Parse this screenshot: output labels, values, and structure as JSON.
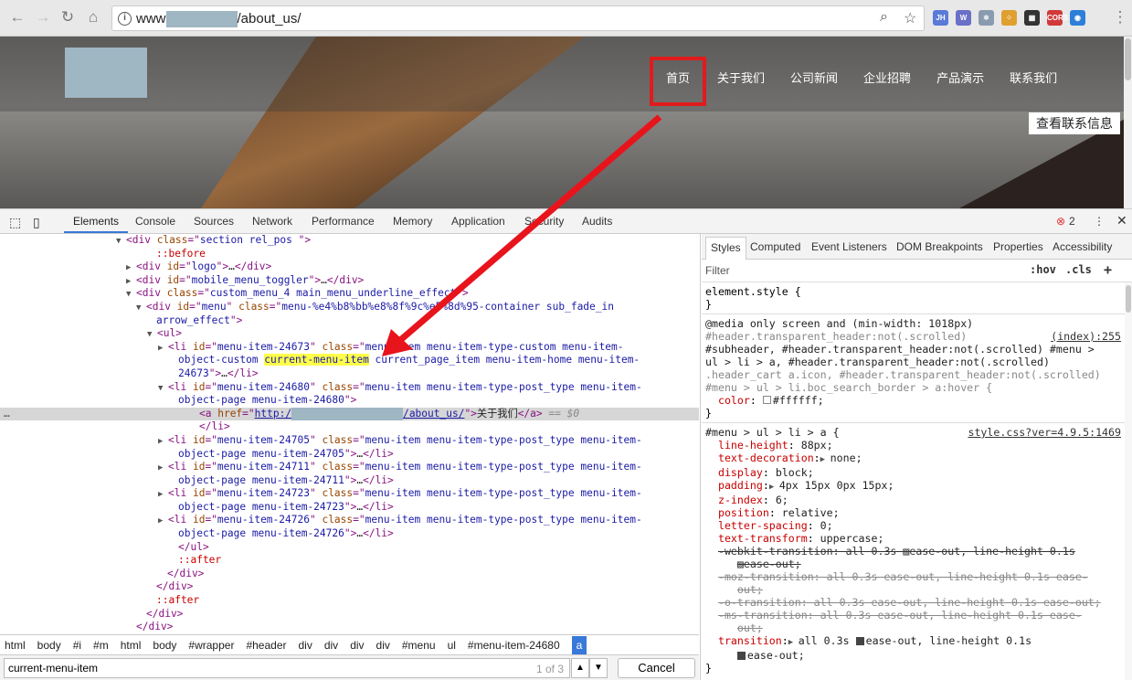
{
  "browser": {
    "url_prefix": "www",
    "url_suffix": "/about_us/",
    "extensions": [
      {
        "label": "JH",
        "color": "#5a7ad8"
      },
      {
        "label": "W",
        "color": "#6a6fc8"
      },
      {
        "label": "⚛",
        "color": "#8a9bb0"
      },
      {
        "label": "⁘",
        "color": "#e0a030"
      },
      {
        "label": "▦",
        "color": "#333333"
      },
      {
        "label": "CORS",
        "color": "#d03a3a"
      },
      {
        "label": "◉",
        "color": "#2d7fd8"
      }
    ]
  },
  "page": {
    "menu": [
      "首页",
      "关于我们",
      "公司新闻",
      "企业招聘",
      "产品演示",
      "联系我们"
    ],
    "contact_button": "查看联系信息"
  },
  "devtools": {
    "tabs": [
      "Elements",
      "Console",
      "Sources",
      "Network",
      "Performance",
      "Memory",
      "Application",
      "Security",
      "Audits"
    ],
    "error_count": "2",
    "elements": [
      {
        "d": 0,
        "a": "▼",
        "p": [
          [
            "tg",
            "<div "
          ],
          [
            "at",
            "class"
          ],
          [
            "tg",
            "=\""
          ],
          [
            "av",
            "section rel_pos "
          ],
          [
            "tg",
            "\">"
          ]
        ]
      },
      {
        "d": 1,
        "a": "",
        "p": [
          [
            "pe",
            "::before"
          ]
        ]
      },
      {
        "d": 1,
        "a": "▶",
        "p": [
          [
            "tg",
            "<div "
          ],
          [
            "at",
            "id"
          ],
          [
            "tg",
            "=\""
          ],
          [
            "av",
            "logo"
          ],
          [
            "tg",
            "\">"
          ],
          [
            "tx",
            "…"
          ],
          [
            "tg",
            "</div>"
          ]
        ]
      },
      {
        "d": 1,
        "a": "▶",
        "p": [
          [
            "tg",
            "<div "
          ],
          [
            "at",
            "id"
          ],
          [
            "tg",
            "=\""
          ],
          [
            "av",
            "mobile_menu_toggler"
          ],
          [
            "tg",
            "\">"
          ],
          [
            "tx",
            "…"
          ],
          [
            "tg",
            "</div>"
          ]
        ]
      },
      {
        "d": 1,
        "a": "▼",
        "p": [
          [
            "tg",
            "<div "
          ],
          [
            "at",
            "class"
          ],
          [
            "tg",
            "=\""
          ],
          [
            "av",
            "custom_menu_4 main_menu_underline_effect"
          ],
          [
            "tg",
            "\">"
          ]
        ]
      },
      {
        "d": 2,
        "a": "▼",
        "p": [
          [
            "tg",
            "<div "
          ],
          [
            "at",
            "id"
          ],
          [
            "tg",
            "=\""
          ],
          [
            "av",
            "menu"
          ],
          [
            "tg",
            "\" "
          ],
          [
            "at",
            "class"
          ],
          [
            "tg",
            "=\""
          ],
          [
            "av",
            "menu-%e4%b8%bb%e8%8f%9c%e5%8d%95-container sub_fade_in"
          ]
        ]
      },
      {
        "d": 2,
        "a": "",
        "p": [
          [
            "av",
            "arrow_effect"
          ],
          [
            "tg",
            "\">"
          ]
        ]
      },
      {
        "d": 3,
        "a": "▼",
        "p": [
          [
            "tg",
            "<ul>"
          ]
        ]
      },
      {
        "d": 4,
        "a": "▶",
        "p": [
          [
            "tg",
            "<li "
          ],
          [
            "at",
            "id"
          ],
          [
            "tg",
            "=\""
          ],
          [
            "av",
            "menu-item-24673"
          ],
          [
            "tg",
            "\" "
          ],
          [
            "at",
            "class"
          ],
          [
            "tg",
            "=\""
          ],
          [
            "av",
            "menu-item menu-item-type-custom menu-item-"
          ]
        ]
      },
      {
        "d": 4,
        "a": "",
        "p": [
          [
            "av",
            "object-custom "
          ],
          [
            "hl",
            "current-menu-item"
          ],
          [
            "av",
            " current_page_item menu-item-home menu-item-"
          ]
        ]
      },
      {
        "d": 4,
        "a": "",
        "p": [
          [
            "av",
            "24673"
          ],
          [
            "tg",
            "\">"
          ],
          [
            "tx",
            "…"
          ],
          [
            "tg",
            "</li>"
          ]
        ]
      },
      {
        "d": 4,
        "a": "▼",
        "p": [
          [
            "tg",
            "<li "
          ],
          [
            "at",
            "id"
          ],
          [
            "tg",
            "=\""
          ],
          [
            "av",
            "menu-item-24680"
          ],
          [
            "tg",
            "\" "
          ],
          [
            "at",
            "class"
          ],
          [
            "tg",
            "=\""
          ],
          [
            "av",
            "menu-item menu-item-type-post_type menu-item-"
          ]
        ]
      },
      {
        "d": 4,
        "a": "",
        "p": [
          [
            "av",
            "object-page menu-item-24680"
          ],
          [
            "tg",
            "\">"
          ]
        ]
      },
      {
        "d": 5,
        "a": "",
        "sel": true,
        "p": [
          [
            "tg",
            "<a "
          ],
          [
            "at",
            "href"
          ],
          [
            "tg",
            "=\""
          ],
          [
            "lk",
            "http:/"
          ],
          [
            "blur",
            ""
          ],
          [
            "lk",
            "/about_us/"
          ],
          [
            "tg",
            "\">"
          ],
          [
            "tx",
            "关于我们"
          ],
          [
            "tg",
            "</a>"
          ],
          [
            "dl",
            " == $0"
          ]
        ]
      },
      {
        "d": 5,
        "a": "",
        "p": [
          [
            "tg",
            "</li>"
          ]
        ]
      },
      {
        "d": 4,
        "a": "▶",
        "p": [
          [
            "tg",
            "<li "
          ],
          [
            "at",
            "id"
          ],
          [
            "tg",
            "=\""
          ],
          [
            "av",
            "menu-item-24705"
          ],
          [
            "tg",
            "\" "
          ],
          [
            "at",
            "class"
          ],
          [
            "tg",
            "=\""
          ],
          [
            "av",
            "menu-item menu-item-type-post_type menu-item-"
          ]
        ]
      },
      {
        "d": 4,
        "a": "",
        "p": [
          [
            "av",
            "object-page menu-item-24705"
          ],
          [
            "tg",
            "\">"
          ],
          [
            "tx",
            "…"
          ],
          [
            "tg",
            "</li>"
          ]
        ]
      },
      {
        "d": 4,
        "a": "▶",
        "p": [
          [
            "tg",
            "<li "
          ],
          [
            "at",
            "id"
          ],
          [
            "tg",
            "=\""
          ],
          [
            "av",
            "menu-item-24711"
          ],
          [
            "tg",
            "\" "
          ],
          [
            "at",
            "class"
          ],
          [
            "tg",
            "=\""
          ],
          [
            "av",
            "menu-item menu-item-type-post_type menu-item-"
          ]
        ]
      },
      {
        "d": 4,
        "a": "",
        "p": [
          [
            "av",
            "object-page menu-item-24711"
          ],
          [
            "tg",
            "\">"
          ],
          [
            "tx",
            "…"
          ],
          [
            "tg",
            "</li>"
          ]
        ]
      },
      {
        "d": 4,
        "a": "▶",
        "p": [
          [
            "tg",
            "<li "
          ],
          [
            "at",
            "id"
          ],
          [
            "tg",
            "=\""
          ],
          [
            "av",
            "menu-item-24723"
          ],
          [
            "tg",
            "\" "
          ],
          [
            "at",
            "class"
          ],
          [
            "tg",
            "=\""
          ],
          [
            "av",
            "menu-item menu-item-type-post_type menu-item-"
          ]
        ]
      },
      {
        "d": 4,
        "a": "",
        "p": [
          [
            "av",
            "object-page menu-item-24723"
          ],
          [
            "tg",
            "\">"
          ],
          [
            "tx",
            "…"
          ],
          [
            "tg",
            "</li>"
          ]
        ]
      },
      {
        "d": 4,
        "a": "▶",
        "p": [
          [
            "tg",
            "<li "
          ],
          [
            "at",
            "id"
          ],
          [
            "tg",
            "=\""
          ],
          [
            "av",
            "menu-item-24726"
          ],
          [
            "tg",
            "\" "
          ],
          [
            "at",
            "class"
          ],
          [
            "tg",
            "=\""
          ],
          [
            "av",
            "menu-item menu-item-type-post_type menu-item-"
          ]
        ]
      },
      {
        "d": 4,
        "a": "",
        "p": [
          [
            "av",
            "object-page menu-item-24726"
          ],
          [
            "tg",
            "\">"
          ],
          [
            "tx",
            "…"
          ],
          [
            "tg",
            "</li>"
          ]
        ]
      },
      {
        "d": 4,
        "a": "",
        "p": [
          [
            "tg",
            "</ul>"
          ]
        ]
      },
      {
        "d": 4,
        "a": "",
        "p": [
          [
            "pe",
            "::after"
          ]
        ]
      },
      {
        "d": 3,
        "a": "",
        "p": [
          [
            "tg",
            "</div>"
          ]
        ]
      },
      {
        "d": 2,
        "a": "",
        "p": [
          [
            "tg",
            "</div>"
          ]
        ]
      },
      {
        "d": 2,
        "a": "",
        "p": [
          [
            "pe",
            "::after"
          ]
        ]
      },
      {
        "d": 1,
        "a": "",
        "p": [
          [
            "tg",
            "</div>"
          ]
        ]
      },
      {
        "d": 0,
        "a": "",
        "p": [
          [
            "tg",
            "</div>"
          ]
        ]
      }
    ],
    "breadcrumbs": [
      "html",
      "body",
      "#i",
      "#m",
      "html",
      "body",
      "#wrapper",
      "#header",
      "div",
      "div",
      "div",
      "div",
      "#menu",
      "ul",
      "#menu-item-24680",
      "a"
    ],
    "search": {
      "value": "current-menu-item",
      "count": "1 of 3",
      "cancel": "Cancel"
    },
    "styles": {
      "tabs": [
        "Styles",
        "Computed",
        "Event Listeners",
        "DOM Breakpoints",
        "Properties",
        "Accessibility"
      ],
      "filter_placeholder": "Filter",
      "hov": ":hov",
      "cls": ".cls",
      "add": "+",
      "element_style": "element.style {",
      "close": "}",
      "media": "@media only screen and (min-width: 1018px)",
      "rule1_src": "(index):255",
      "rule1_sel": [
        "#header.transparent_header:not(.scrolled)",
        "#subheader, #header.transparent_header:not(.scrolled) #menu >",
        "ul > li > a, #header.transparent_header:not(.scrolled)",
        ".header_cart a.icon, #header.transparent_header:not(.scrolled)",
        "#menu > ul > li.boc_search_border > a:hover {"
      ],
      "rule1_prop": "color",
      "rule1_val": "#ffffff;",
      "rule2_sel": "#menu > ul > li > a {",
      "rule2_src": "style.css?ver=4.9.5:1469",
      "rule2_props": [
        {
          "n": "line-height",
          "v": "88px;"
        },
        {
          "n": "text-decoration",
          "v": "none;",
          "x": true
        },
        {
          "n": "display",
          "v": "block;"
        },
        {
          "n": "padding",
          "v": "4px 15px 0px 15px;",
          "x": true
        },
        {
          "n": "z-index",
          "v": "6;"
        },
        {
          "n": "position",
          "v": "relative;"
        },
        {
          "n": "letter-spacing",
          "v": "0;"
        },
        {
          "n": "text-transform",
          "v": "uppercase;"
        }
      ],
      "struck": [
        "-webkit-transition: all 0.3s ▨ease-out, line-height 0.1s",
        "▨ease-out;",
        "-moz-transition: all 0.3s ease-out, line-height 0.1s ease-",
        "out;",
        "-o-transition: all 0.3s ease-out, line-height 0.1s ease-out;",
        "-ms-transition: all 0.3s ease-out, line-height 0.1s ease-",
        "out;"
      ],
      "transition_name": "transition",
      "transition_val": "all 0.3s ",
      "transition_val2": "ease-out, line-height 0.1s",
      "transition_val3": "ease-out;"
    }
  },
  "colors": {
    "accent": "#3879d9",
    "annotation": "#e01b1b",
    "highlight": "#ffff4a"
  }
}
